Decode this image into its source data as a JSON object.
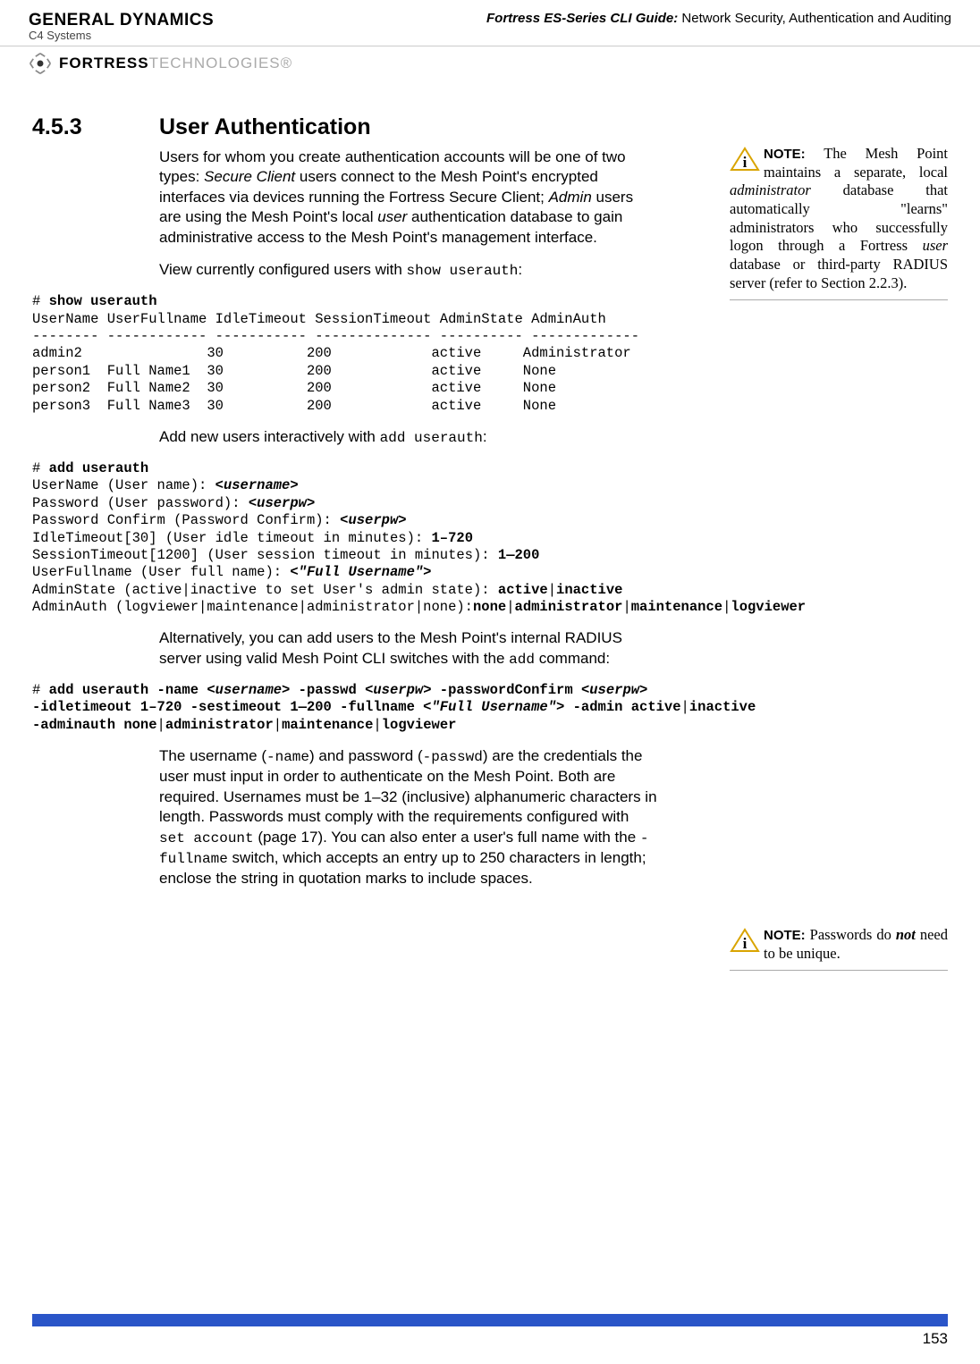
{
  "header": {
    "brand_line1": "GENERAL DYNAMICS",
    "brand_line2": "C4 Systems",
    "doc_title_italic": "Fortress ES-Series CLI Guide:",
    "doc_title_rest": " Network Security, Authentication and Auditing",
    "fortress": "FORTRESS",
    "fortress_grey": "TECHNOLOGIES®"
  },
  "section": {
    "num": "4.5.3",
    "title": "User Authentication"
  },
  "paras": {
    "p1a": "Users for whom you create authentication accounts will be one of two types: ",
    "p1b": "Secure Client",
    "p1c": " users connect to the Mesh Point's encrypted interfaces via devices running the Fortress Secure Client; ",
    "p1d": "Admin",
    "p1e": " users are using the Mesh Point's local ",
    "p1f": "user",
    "p1g": " authentication database to gain administrative access to the Mesh Point's management interface.",
    "p2a": "View currently configured users with ",
    "p2b": "show userauth",
    "p2c": ":",
    "p3a": "Add new users interactively with ",
    "p3b": "add userauth",
    "p3c": ":",
    "p4": "Alternatively, you can add users to the Mesh Point's internal RADIUS server using valid Mesh Point CLI switches with the ",
    "p4b": "add",
    "p4c": " command:",
    "p5a": "The username (",
    "p5b": "-name",
    "p5c": ") and password (",
    "p5d": "-passwd",
    "p5e": ") are the credentials the user must input in order to authenticate on the Mesh Point. Both are required. Usernames must be 1–32 (inclusive) alphanumeric characters in length. Passwords must comply with the requirements configured with ",
    "p5f": "set account",
    "p5g": " (page 17). You can also enter a user's full name with the ",
    "p5h": "-fullname",
    "p5i": " switch, which accepts an entry up to 250 characters in length; enclose the string in quotation marks to include spaces."
  },
  "notes": {
    "n1_label": "NOTE:",
    "n1a": " The Mesh Point maintains a separate, local ",
    "n1b": "administrator",
    "n1c": " database that automatically \"learns\" administrators who successfully logon through a Fortress ",
    "n1d": "user",
    "n1e": " database or third-party RADIUS server (refer to Section 2.2.3).",
    "n2_label": "NOTE:",
    "n2a": " Passwords do ",
    "n2b": "not",
    "n2c": " need to be unique."
  },
  "code1": {
    "l1": "# ",
    "l1b": "show userauth",
    "l2": "UserName UserFullname IdleTimeout SessionTimeout AdminState AdminAuth",
    "l3": "-------- ------------ ----------- -------------- ---------- -------------",
    "l4": "admin2               30          200            active     Administrator",
    "l5": "person1  Full Name1  30          200            active     None",
    "l6": "person2  Full Name2  30          200            active     None",
    "l7": "person3  Full Name3  30          200            active     None"
  },
  "code2": {
    "l1": "# ",
    "l1b": "add userauth",
    "l2a": "UserName (User name): ",
    "l2b": "<username>",
    "l3a": "Password (User password): ",
    "l3b": "<userpw>",
    "l4a": "Password Confirm (Password Confirm): ",
    "l4b": "<userpw>",
    "l5a": "IdleTimeout[30] (User idle timeout in minutes): ",
    "l5b": "1–720",
    "l6a": "SessionTimeout[1200] (User session timeout in minutes): ",
    "l6b": "1—200",
    "l7a": "UserFullname (User full name): ",
    "l7b": "<\"Full Username\">",
    "l8a": "AdminState (active|inactive to set User's admin state): ",
    "l8b": "active",
    "l8c": "|",
    "l8d": "inactive",
    "l9a": "AdminAuth (logviewer|maintenance|administrator|none):",
    "l9b": "none",
    "l9c": "|",
    "l9d": "administrator",
    "l9e": "|",
    "l9f": "maintenance",
    "l9g": "|",
    "l9h": "logviewer"
  },
  "code3": {
    "l1": "# ",
    "l1b": "add userauth -name ",
    "l1c": "<username>",
    "l1d": " -passwd ",
    "l1e": "<userpw>",
    "l1f": " -passwordConfirm ",
    "l1g": "<userpw>",
    "l2a": "-idletimeout 1–720 -sestimeout 1—200 -fullname ",
    "l2b": "<\"Full Username\">",
    "l2c": " -admin active",
    "l2d": "|",
    "l2e": "inactive",
    "l3a": "-adminauth none",
    "l3b": "|",
    "l3c": "administrator",
    "l3d": "|",
    "l3e": "maintenance",
    "l3f": "|",
    "l3g": "logviewer"
  },
  "footer": {
    "page": "153"
  }
}
